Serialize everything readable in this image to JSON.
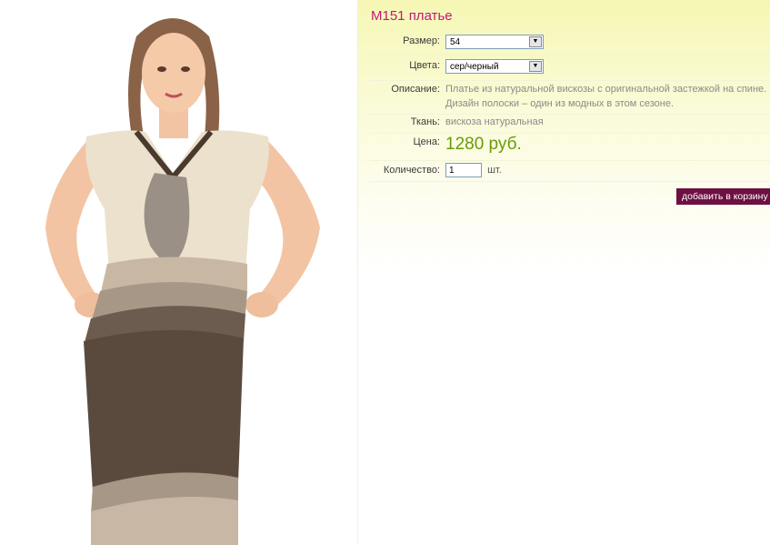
{
  "product": {
    "title": "M151 платье",
    "size_label": "Размер:",
    "size_value": "54",
    "color_label": "Цвета:",
    "color_value": "сер/черный",
    "description_label": "Описание:",
    "description_line1": "Платье из натуральной вискозы с оригинальной застежкой на спине.",
    "description_line2": "Дизайн полоски – один из модных в этом сезоне.",
    "fabric_label": "Ткань:",
    "fabric_value": "вискоза натуральная",
    "price_label": "Цена:",
    "price_value": "1280 руб.",
    "quantity_label": "Количество:",
    "quantity_value": "1",
    "quantity_unit": "шт.",
    "add_to_cart_label": "добавить в корзину"
  },
  "icons": {
    "dropdown": "chevron-down-icon"
  },
  "colors": {
    "title": "#c2187a",
    "price": "#6a9a0a",
    "button": "#6e1041",
    "panel_top": "#f6f7b4"
  }
}
